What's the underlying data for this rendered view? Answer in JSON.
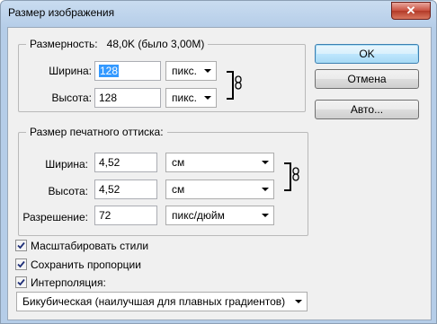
{
  "window": {
    "title": "Размер изображения",
    "close_label": "✕"
  },
  "pixel_dimensions": {
    "legend_prefix": "Размерность:",
    "legend_value": "48,0K (было 3,00M)",
    "width_label": "Ширина:",
    "width_value": "128",
    "width_unit": "пикс.",
    "height_label": "Высота:",
    "height_value": "128",
    "height_unit": "пикс."
  },
  "document_size": {
    "legend": "Размер печатного оттиска:",
    "width_label": "Ширина:",
    "width_value": "4,52",
    "width_unit": "см",
    "height_label": "Высота:",
    "height_value": "4,52",
    "height_unit": "см",
    "resolution_label": "Разрешение:",
    "resolution_value": "72",
    "resolution_unit": "пикс/дюйм"
  },
  "buttons": {
    "ok": "OK",
    "cancel": "Отмена",
    "auto": "Авто..."
  },
  "options": {
    "scale_styles": {
      "label": "Масштабировать стили",
      "checked": true
    },
    "constrain": {
      "label": "Сохранить пропорции",
      "checked": true
    },
    "resample": {
      "label": "Интерполяция:",
      "checked": true
    }
  },
  "resample_method": "Бикубическая (наилучшая для плавных градиентов)",
  "colors": {
    "title_bar": "#b5cde8",
    "close_button": "#c9503f",
    "selection": "#3399ff"
  }
}
